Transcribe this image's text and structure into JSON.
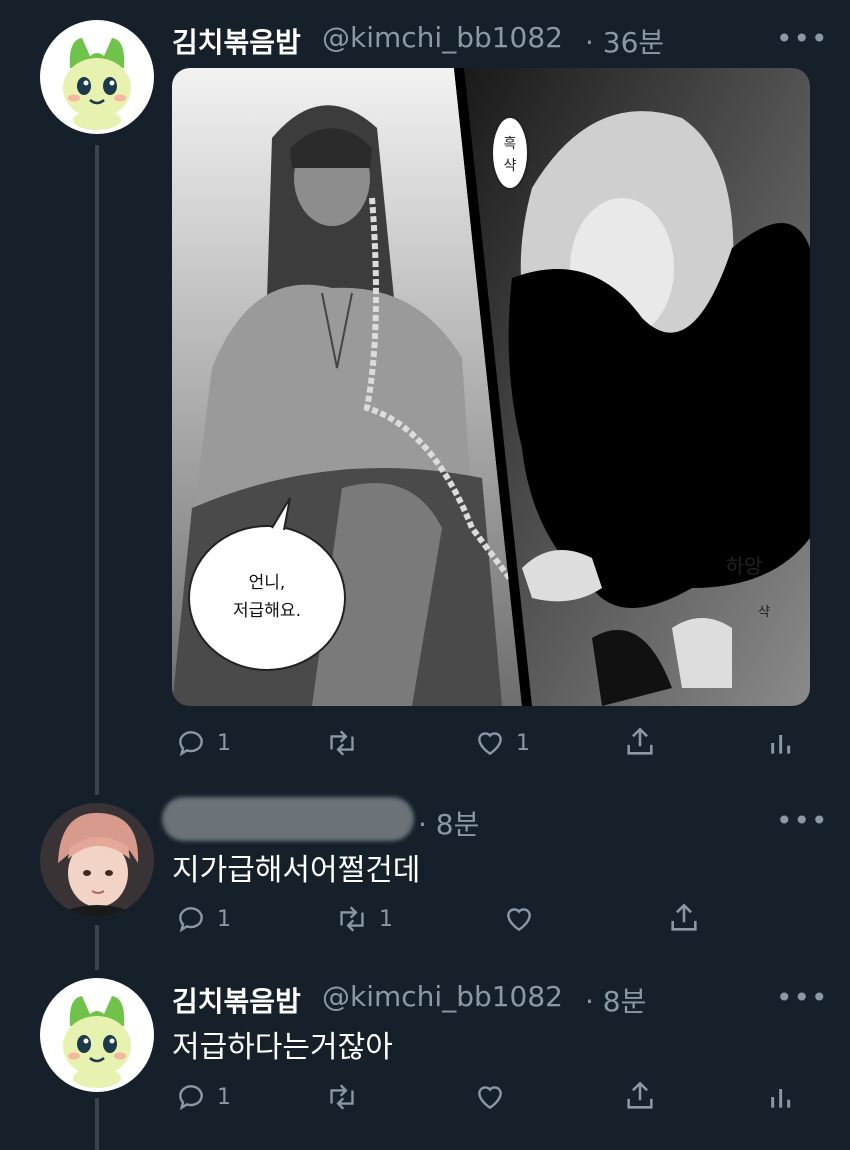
{
  "tweets": [
    {
      "name": "김치볶음밥",
      "handle": "@kimchi_bb1082",
      "time": "· 36분",
      "more": "•••",
      "image": {
        "bubble_line1": "언니,",
        "bubble_line2": "저급해요.",
        "sfx1": "흑",
        "sfx2": "샥",
        "sfx3": "하앙",
        "sfx4": "샥"
      },
      "reply_count": "1",
      "retweet_count": "",
      "like_count": "1"
    },
    {
      "name": "",
      "handle": "",
      "time": "· 8분",
      "more": "•••",
      "text": "지가급해서어쩔건데",
      "reply_count": "1",
      "retweet_count": "1",
      "like_count": ""
    },
    {
      "name": "김치볶음밥",
      "handle": "@kimchi_bb1082",
      "time": "· 8분",
      "more": "•••",
      "text": "저급하다는거잖아",
      "reply_count": "1",
      "retweet_count": "",
      "like_count": ""
    }
  ],
  "icons": [
    "reply-icon",
    "retweet-icon",
    "like-icon",
    "share-icon",
    "analytics-icon",
    "more-icon"
  ]
}
